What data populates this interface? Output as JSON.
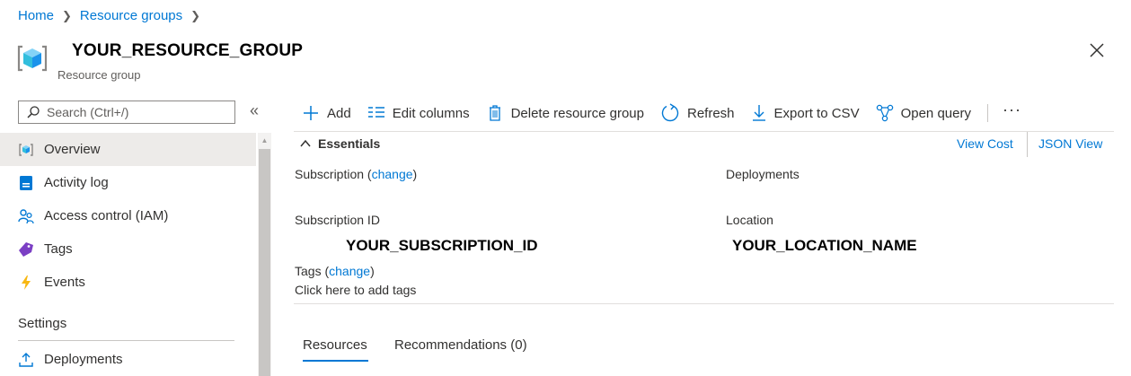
{
  "breadcrumb": [
    {
      "label": "Home"
    },
    {
      "label": "Resource groups"
    }
  ],
  "header": {
    "title": "YOUR_RESOURCE_GROUP",
    "subtitle": "Resource group"
  },
  "sidebar": {
    "search_placeholder": "Search (Ctrl+/)",
    "collapse_glyph": "«",
    "items": [
      {
        "label": "Overview",
        "icon": "resource-group-icon",
        "active": true
      },
      {
        "label": "Activity log",
        "icon": "activity-log-icon"
      },
      {
        "label": "Access control (IAM)",
        "icon": "people-icon"
      },
      {
        "label": "Tags",
        "icon": "tag-icon"
      },
      {
        "label": "Events",
        "icon": "lightning-icon"
      }
    ],
    "section_settings": "Settings",
    "settings_items": [
      {
        "label": "Deployments",
        "icon": "upload-icon"
      }
    ]
  },
  "toolbar": {
    "add": "Add",
    "edit_columns": "Edit columns",
    "delete": "Delete resource group",
    "refresh": "Refresh",
    "export": "Export to CSV",
    "open_query": "Open query",
    "more": "···"
  },
  "essentials": {
    "title": "Essentials",
    "view_cost": "View Cost",
    "json_view": "JSON View",
    "subscription_label": "Subscription",
    "change": "change",
    "deployments_label": "Deployments",
    "subscription_id_label": "Subscription ID",
    "subscription_id_value": "YOUR_SUBSCRIPTION_ID",
    "location_label": "Location",
    "location_value": "YOUR_LOCATION_NAME",
    "tags_label": "Tags",
    "tags_link": "Click here to add tags"
  },
  "tabs": [
    {
      "label": "Resources",
      "active": true
    },
    {
      "label": "Recommendations (0)"
    }
  ],
  "colors": {
    "accent": "#0078d4",
    "text": "#323130",
    "active_nav_bg": "#edebe9"
  }
}
